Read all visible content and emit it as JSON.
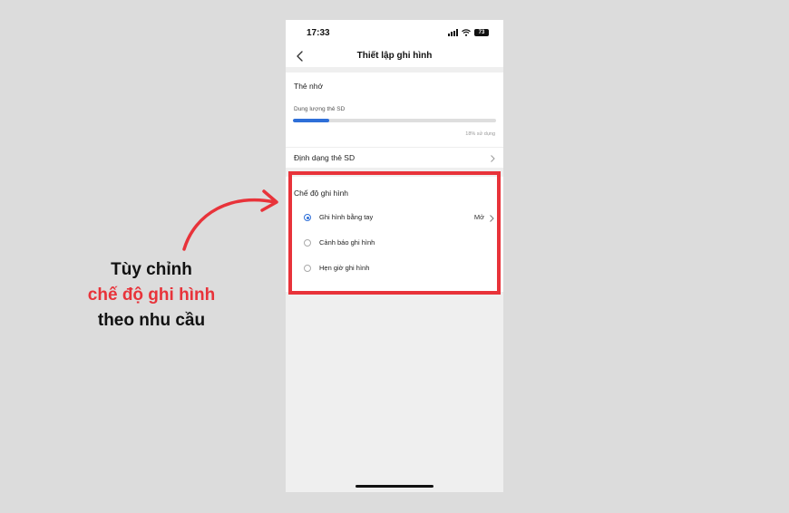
{
  "status_bar": {
    "time": "17:33",
    "battery": "73"
  },
  "header": {
    "title": "Thiết lập ghi hình"
  },
  "memory_card": {
    "title": "Thẻ nhớ",
    "storage_label": "Dung lượng thẻ SD",
    "usage_fraction": 0.18,
    "usage_text": "18% sử dụng",
    "format_label": "Định dạng thẻ SD"
  },
  "recording_mode": {
    "title": "Chế độ ghi hình",
    "options": [
      {
        "label": "Ghi hình bằng tay",
        "value": "Mở",
        "selected": true
      },
      {
        "label": "Cảnh báo ghi hình",
        "selected": false
      },
      {
        "label": "Hẹn giờ ghi hình",
        "selected": false
      }
    ]
  },
  "annotation": {
    "line1": "Tùy chỉnh",
    "line2": "chế độ ghi hình",
    "line3": "theo nhu cầu",
    "accent_color": "#e8333a"
  },
  "colors": {
    "accent_blue": "#2e6fd8",
    "highlight_red": "#e8333a"
  },
  "icons": [
    "back-arrow-icon",
    "signal-icon",
    "wifi-icon",
    "battery-icon",
    "chevron-right-icon",
    "radio-selected-icon",
    "radio-unselected-icon",
    "curved-arrow-icon"
  ]
}
